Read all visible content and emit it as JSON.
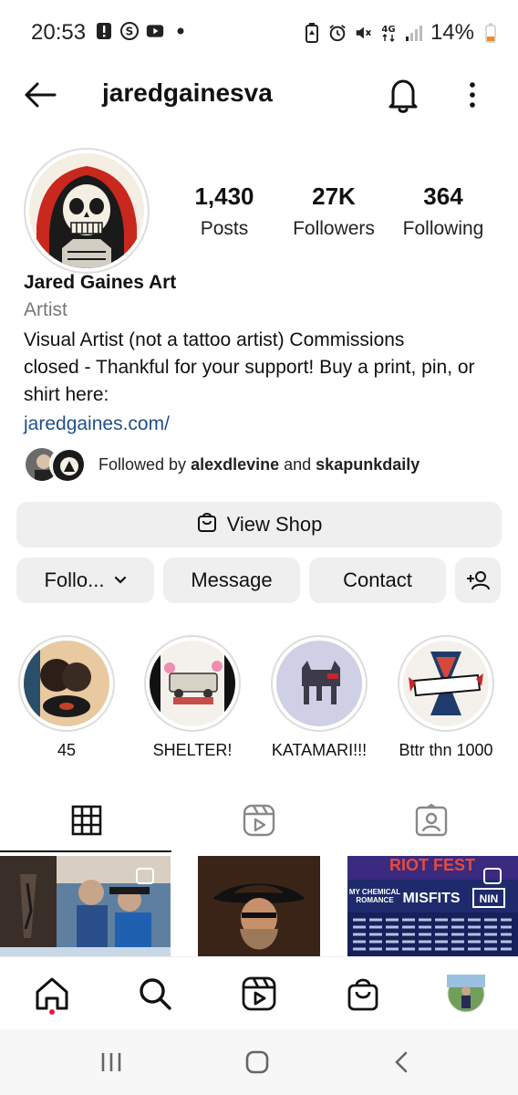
{
  "status_bar": {
    "time": "20:53",
    "battery": "14%",
    "left_icons": [
      "alert-icon",
      "s-app-icon",
      "youtube-icon",
      "dot-icon"
    ],
    "right_icons": [
      "battery-saver-icon",
      "alarm-icon",
      "mute-icon",
      "4g-icon",
      "signal-icon",
      "battery-icon"
    ]
  },
  "header": {
    "username": "jaredgainesva",
    "back_icon": "arrow-left-icon",
    "bell_icon": "bell-icon",
    "more_icon": "more-vertical-icon"
  },
  "profile": {
    "stats": [
      {
        "value": "1,430",
        "label": "Posts"
      },
      {
        "value": "27K",
        "label": "Followers"
      },
      {
        "value": "364",
        "label": "Following"
      }
    ],
    "name": "Jared Gaines Art",
    "category": "Artist",
    "bio_lines": [
      "Visual Artist (not a tattoo artist) Commissions",
      "closed - Thankful for your support! Buy a print, pin, or",
      "shirt here:"
    ],
    "link": "jaredgaines.com/",
    "followed_by": {
      "prefix": "Followed by ",
      "user1": "alexdlevine",
      "joiner": " and ",
      "user2": "skapunkdaily"
    }
  },
  "actions": {
    "view_shop": "View Shop",
    "follow": "Follo...",
    "message": "Message",
    "contact": "Contact"
  },
  "highlights": [
    {
      "label": "45"
    },
    {
      "label": "SHELTER!"
    },
    {
      "label": "KATAMARI!!!"
    },
    {
      "label": "Bttr thn 1000"
    }
  ],
  "tabs": [
    "grid-icon",
    "reels-icon",
    "tagged-icon"
  ],
  "bottom_nav": [
    "home-icon",
    "search-icon",
    "reels-icon",
    "shop-icon",
    "profile-avatar"
  ],
  "colors": {
    "link": "#1f4f8c",
    "button_bg": "#efefef",
    "notification_dot": "#e2203a"
  }
}
